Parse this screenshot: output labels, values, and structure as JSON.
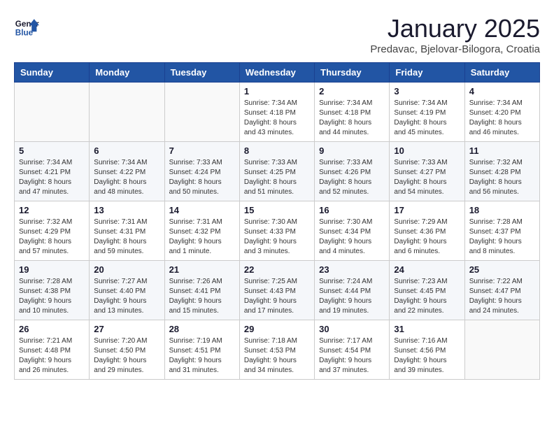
{
  "header": {
    "logo_line1": "General",
    "logo_line2": "Blue",
    "month": "January 2025",
    "location": "Predavac, Bjelovar-Bilogora, Croatia"
  },
  "weekdays": [
    "Sunday",
    "Monday",
    "Tuesday",
    "Wednesday",
    "Thursday",
    "Friday",
    "Saturday"
  ],
  "weeks": [
    [
      {
        "day": "",
        "info": ""
      },
      {
        "day": "",
        "info": ""
      },
      {
        "day": "",
        "info": ""
      },
      {
        "day": "1",
        "info": "Sunrise: 7:34 AM\nSunset: 4:18 PM\nDaylight: 8 hours and 43 minutes."
      },
      {
        "day": "2",
        "info": "Sunrise: 7:34 AM\nSunset: 4:18 PM\nDaylight: 8 hours and 44 minutes."
      },
      {
        "day": "3",
        "info": "Sunrise: 7:34 AM\nSunset: 4:19 PM\nDaylight: 8 hours and 45 minutes."
      },
      {
        "day": "4",
        "info": "Sunrise: 7:34 AM\nSunset: 4:20 PM\nDaylight: 8 hours and 46 minutes."
      }
    ],
    [
      {
        "day": "5",
        "info": "Sunrise: 7:34 AM\nSunset: 4:21 PM\nDaylight: 8 hours and 47 minutes."
      },
      {
        "day": "6",
        "info": "Sunrise: 7:34 AM\nSunset: 4:22 PM\nDaylight: 8 hours and 48 minutes."
      },
      {
        "day": "7",
        "info": "Sunrise: 7:33 AM\nSunset: 4:24 PM\nDaylight: 8 hours and 50 minutes."
      },
      {
        "day": "8",
        "info": "Sunrise: 7:33 AM\nSunset: 4:25 PM\nDaylight: 8 hours and 51 minutes."
      },
      {
        "day": "9",
        "info": "Sunrise: 7:33 AM\nSunset: 4:26 PM\nDaylight: 8 hours and 52 minutes."
      },
      {
        "day": "10",
        "info": "Sunrise: 7:33 AM\nSunset: 4:27 PM\nDaylight: 8 hours and 54 minutes."
      },
      {
        "day": "11",
        "info": "Sunrise: 7:32 AM\nSunset: 4:28 PM\nDaylight: 8 hours and 56 minutes."
      }
    ],
    [
      {
        "day": "12",
        "info": "Sunrise: 7:32 AM\nSunset: 4:29 PM\nDaylight: 8 hours and 57 minutes."
      },
      {
        "day": "13",
        "info": "Sunrise: 7:31 AM\nSunset: 4:31 PM\nDaylight: 8 hours and 59 minutes."
      },
      {
        "day": "14",
        "info": "Sunrise: 7:31 AM\nSunset: 4:32 PM\nDaylight: 9 hours and 1 minute."
      },
      {
        "day": "15",
        "info": "Sunrise: 7:30 AM\nSunset: 4:33 PM\nDaylight: 9 hours and 3 minutes."
      },
      {
        "day": "16",
        "info": "Sunrise: 7:30 AM\nSunset: 4:34 PM\nDaylight: 9 hours and 4 minutes."
      },
      {
        "day": "17",
        "info": "Sunrise: 7:29 AM\nSunset: 4:36 PM\nDaylight: 9 hours and 6 minutes."
      },
      {
        "day": "18",
        "info": "Sunrise: 7:28 AM\nSunset: 4:37 PM\nDaylight: 9 hours and 8 minutes."
      }
    ],
    [
      {
        "day": "19",
        "info": "Sunrise: 7:28 AM\nSunset: 4:38 PM\nDaylight: 9 hours and 10 minutes."
      },
      {
        "day": "20",
        "info": "Sunrise: 7:27 AM\nSunset: 4:40 PM\nDaylight: 9 hours and 13 minutes."
      },
      {
        "day": "21",
        "info": "Sunrise: 7:26 AM\nSunset: 4:41 PM\nDaylight: 9 hours and 15 minutes."
      },
      {
        "day": "22",
        "info": "Sunrise: 7:25 AM\nSunset: 4:43 PM\nDaylight: 9 hours and 17 minutes."
      },
      {
        "day": "23",
        "info": "Sunrise: 7:24 AM\nSunset: 4:44 PM\nDaylight: 9 hours and 19 minutes."
      },
      {
        "day": "24",
        "info": "Sunrise: 7:23 AM\nSunset: 4:45 PM\nDaylight: 9 hours and 22 minutes."
      },
      {
        "day": "25",
        "info": "Sunrise: 7:22 AM\nSunset: 4:47 PM\nDaylight: 9 hours and 24 minutes."
      }
    ],
    [
      {
        "day": "26",
        "info": "Sunrise: 7:21 AM\nSunset: 4:48 PM\nDaylight: 9 hours and 26 minutes."
      },
      {
        "day": "27",
        "info": "Sunrise: 7:20 AM\nSunset: 4:50 PM\nDaylight: 9 hours and 29 minutes."
      },
      {
        "day": "28",
        "info": "Sunrise: 7:19 AM\nSunset: 4:51 PM\nDaylight: 9 hours and 31 minutes."
      },
      {
        "day": "29",
        "info": "Sunrise: 7:18 AM\nSunset: 4:53 PM\nDaylight: 9 hours and 34 minutes."
      },
      {
        "day": "30",
        "info": "Sunrise: 7:17 AM\nSunset: 4:54 PM\nDaylight: 9 hours and 37 minutes."
      },
      {
        "day": "31",
        "info": "Sunrise: 7:16 AM\nSunset: 4:56 PM\nDaylight: 9 hours and 39 minutes."
      },
      {
        "day": "",
        "info": ""
      }
    ]
  ]
}
